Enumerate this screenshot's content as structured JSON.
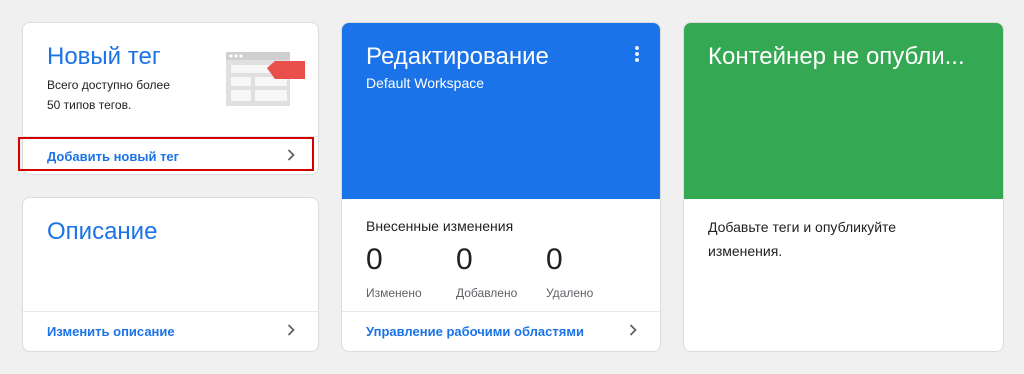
{
  "new_tag_card": {
    "title": "Новый тег",
    "description_line1": "Всего доступно более",
    "description_line2": "50 типов тегов.",
    "link": "Добавить новый тег",
    "illustration_icon": "tag-template-icon"
  },
  "description_card": {
    "title": "Описание",
    "link": "Изменить описание"
  },
  "workspace_card": {
    "title": "Редактирование",
    "subtitle": "Default Workspace",
    "header_color": "#1a73e8",
    "menu_icon": "more-vert-icon",
    "changes_title": "Внесенные изменения",
    "stats": [
      {
        "value": "0",
        "label": "Изменено"
      },
      {
        "value": "0",
        "label": "Добавлено"
      },
      {
        "value": "0",
        "label": "Удалено"
      }
    ],
    "link": "Управление рабочими областями"
  },
  "container_card": {
    "title": "Контейнер не опубли...",
    "header_color": "#34a853",
    "text_line1": "Добавьте теги и опубликуйте",
    "text_line2": "изменения."
  },
  "colors": {
    "accent_blue": "#1a73e8",
    "highlight_red": "#d50000",
    "tag_red": "#e94f4b"
  }
}
